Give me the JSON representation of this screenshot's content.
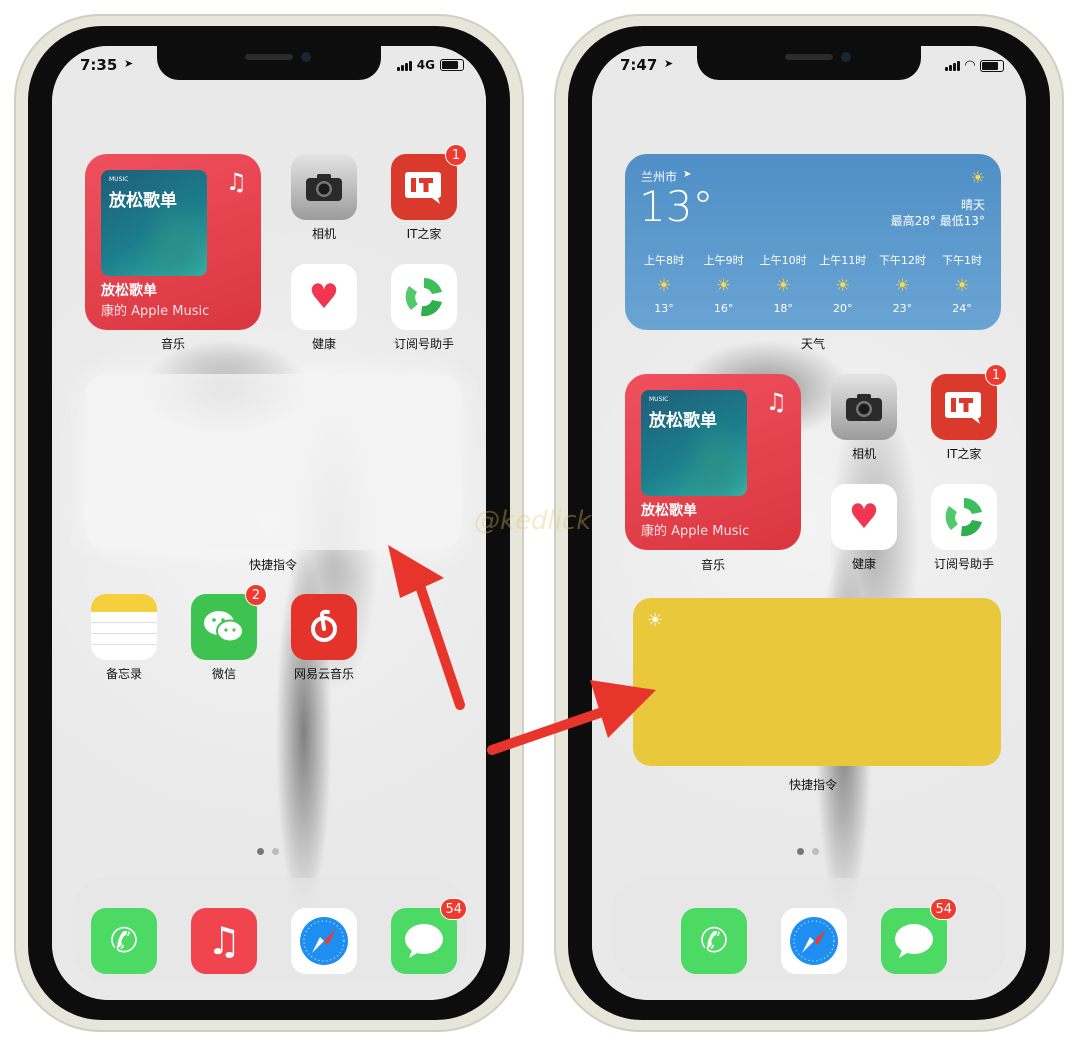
{
  "left_phone": {
    "status": {
      "time": "7:35",
      "network": "4G"
    },
    "music_widget": {
      "art_source": "MUSIC",
      "art_title": "放松歌单",
      "title": "放松歌单",
      "subtitle": "康的 Apple Music",
      "label": "音乐"
    },
    "apps_top": [
      {
        "label": "相机",
        "icon": "camera-icon"
      },
      {
        "label": "IT之家",
        "icon": "it-home-icon",
        "badge": "1"
      },
      {
        "label": "健康",
        "icon": "heart-icon"
      },
      {
        "label": "订阅号助手",
        "icon": "subscription-assistant-icon"
      }
    ],
    "shortcuts_widget": {
      "label": "快捷指令"
    },
    "apps_row": [
      {
        "label": "备忘录",
        "icon": "notes-icon"
      },
      {
        "label": "微信",
        "icon": "wechat-icon",
        "badge": "2"
      },
      {
        "label": "网易云音乐",
        "icon": "netease-music-icon"
      }
    ],
    "dock": [
      {
        "icon": "phone-icon"
      },
      {
        "icon": "music-icon"
      },
      {
        "icon": "safari-icon"
      },
      {
        "icon": "messages-icon",
        "badge": "54"
      }
    ]
  },
  "right_phone": {
    "status": {
      "time": "7:47"
    },
    "weather": {
      "city": "兰州市",
      "temp": "13°",
      "condition": "晴天",
      "range": "最高28° 最低13°",
      "hours": [
        {
          "time": "上午8时",
          "temp": "13°"
        },
        {
          "time": "上午9时",
          "temp": "16°"
        },
        {
          "time": "上午10时",
          "temp": "18°"
        },
        {
          "time": "上午11时",
          "temp": "20°"
        },
        {
          "time": "下午12时",
          "temp": "23°"
        },
        {
          "time": "下午1时",
          "temp": "24°"
        }
      ],
      "label": "天气"
    },
    "music_widget": {
      "art_source": "MUSIC",
      "art_title": "放松歌单",
      "title": "放松歌单",
      "subtitle": "康的 Apple Music",
      "label": "音乐"
    },
    "apps_top": [
      {
        "label": "相机",
        "icon": "camera-icon"
      },
      {
        "label": "IT之家",
        "icon": "it-home-icon",
        "badge": "1"
      },
      {
        "label": "健康",
        "icon": "heart-icon"
      },
      {
        "label": "订阅号助手",
        "icon": "subscription-assistant-icon"
      }
    ],
    "shortcuts_widget": {
      "label": "快捷指令",
      "color": "#e9c83c"
    },
    "dock": [
      {
        "icon": "phone-icon"
      },
      {
        "icon": "safari-icon"
      },
      {
        "icon": "messages-icon",
        "badge": "54"
      }
    ]
  },
  "watermark": "@kedlick",
  "colors": {
    "arrow": "#e8352b",
    "music_widget": "#e54450",
    "weather_widget": "#5a98cc",
    "shortcut_yellow": "#e9c83c"
  }
}
